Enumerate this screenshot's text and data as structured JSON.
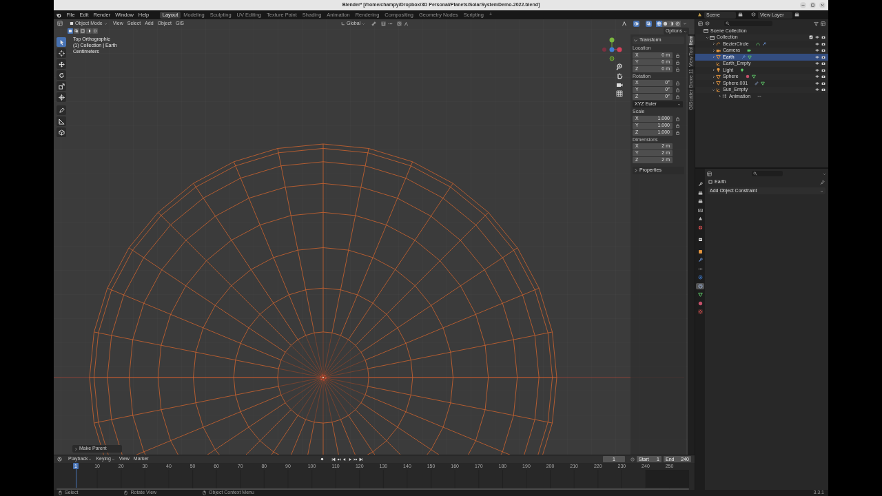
{
  "window": {
    "title": "Blender* [/home/champy/Dropbox/3D Personal/Planets/SolarSystemDemo-2022.blend]"
  },
  "menu": [
    "File",
    "Edit",
    "Render",
    "Window",
    "Help"
  ],
  "workspaces": [
    {
      "label": "Layout",
      "selected": true
    },
    {
      "label": "Modeling",
      "selected": false
    },
    {
      "label": "Sculpting",
      "selected": false
    },
    {
      "label": "UV Editing",
      "selected": false
    },
    {
      "label": "Texture Paint",
      "selected": false
    },
    {
      "label": "Shading",
      "selected": false
    },
    {
      "label": "Animation",
      "selected": false
    },
    {
      "label": "Rendering",
      "selected": false
    },
    {
      "label": "Compositing",
      "selected": false
    },
    {
      "label": "Geometry Nodes",
      "selected": false
    },
    {
      "label": "Scripting",
      "selected": false
    }
  ],
  "add_workspace": "+",
  "scene": "Scene",
  "view_layer": "View Layer",
  "viewport": {
    "mode": "Object Mode",
    "menus": [
      "View",
      "Select",
      "Add",
      "Object",
      "GIS"
    ],
    "orientation": "Global",
    "overlays": true,
    "xray": true,
    "shading": [
      {
        "kind": "wireframe",
        "selected": true
      },
      {
        "kind": "solid",
        "selected": false
      },
      {
        "kind": "material",
        "selected": false
      },
      {
        "kind": "rendered",
        "selected": false
      }
    ],
    "options": "Options",
    "select_modes": [
      {
        "kind": "set",
        "selected": true
      },
      {
        "kind": "extend",
        "selected": false
      },
      {
        "kind": "subtract",
        "selected": false
      },
      {
        "kind": "invert",
        "selected": false
      },
      {
        "kind": "intersect",
        "selected": false
      }
    ],
    "tools": [
      {
        "kind": "select",
        "selected": true
      },
      {
        "kind": "cursor",
        "selected": false
      },
      {
        "kind": "move",
        "selected": false
      },
      {
        "kind": "rotate",
        "selected": false
      },
      {
        "kind": "scale",
        "selected": false
      },
      {
        "kind": "transform",
        "selected": false
      },
      {
        "kind": "annotate",
        "selected": false
      },
      {
        "kind": "measure",
        "selected": false
      },
      {
        "kind": "add_cube",
        "selected": false
      }
    ],
    "overlay_text": [
      "Top Orthographic",
      "(1) Collection | Earth",
      "Centimeters"
    ],
    "last_operator": "Make Parent"
  },
  "sidebar": {
    "tabs": [
      {
        "label": "Item",
        "selected": true
      },
      {
        "label": "Tool",
        "selected": false
      },
      {
        "label": "View",
        "selected": false
      },
      {
        "label": "Grove 11",
        "selected": false
      },
      {
        "label": "GIScatter",
        "selected": false
      }
    ],
    "panels": [
      {
        "title": "Transform",
        "expanded": true,
        "groups": [
          {
            "kind": "vector",
            "label": "Location",
            "lockable": true,
            "fields": [
              {
                "axis": "X",
                "value": "0 m"
              },
              {
                "axis": "Y",
                "value": "0 m"
              },
              {
                "axis": "Z",
                "value": "0 m"
              }
            ]
          },
          {
            "kind": "vector",
            "label": "Rotation",
            "lockable": true,
            "fields": [
              {
                "axis": "X",
                "value": "0°"
              },
              {
                "axis": "Y",
                "value": "0°"
              },
              {
                "axis": "Z",
                "value": "0°"
              }
            ]
          },
          {
            "kind": "dropdown",
            "value": "XYZ Euler"
          },
          {
            "kind": "vector",
            "label": "Scale",
            "lockable": true,
            "fields": [
              {
                "axis": "X",
                "value": "1.000"
              },
              {
                "axis": "Y",
                "value": "1.000"
              },
              {
                "axis": "Z",
                "value": "1.000"
              }
            ]
          },
          {
            "kind": "vector",
            "label": "Dimensions",
            "lockable": false,
            "fields": [
              {
                "axis": "X",
                "value": "2 m"
              },
              {
                "axis": "Y",
                "value": "2 m"
              },
              {
                "axis": "Z",
                "value": "2 m"
              }
            ]
          }
        ]
      },
      {
        "title": "Properties",
        "expanded": false
      }
    ]
  },
  "outliner": {
    "tree": [
      {
        "label": "Scene Collection",
        "kind": "scene_collection",
        "selected": false,
        "children": [
          {
            "label": "Collection",
            "kind": "collection",
            "selected": false,
            "expanded": true,
            "checked": true,
            "visible": true,
            "children": [
              {
                "label": "BezierCircle",
                "kind": "curve",
                "selected": false,
                "expanded": false,
                "visible": true,
                "extras": [
                  {
                    "kind": "curve_data"
                  },
                  {
                    "kind": "modifier"
                  }
                ]
              },
              {
                "label": "Camera",
                "kind": "camera",
                "selected": false,
                "expanded": false,
                "visible": true,
                "extras": [
                  {
                    "kind": "camera_data"
                  }
                ]
              },
              {
                "label": "Earth",
                "kind": "mesh",
                "selected": true,
                "expanded": false,
                "visible": true,
                "extras": [
                  {
                    "kind": "modifier"
                  },
                  {
                    "kind": "mesh_data"
                  }
                ]
              },
              {
                "label": "Earth_Empty",
                "kind": "empty",
                "selected": false,
                "visible": true
              },
              {
                "label": "Light",
                "kind": "light",
                "selected": false,
                "expanded": false,
                "visible": true,
                "extras": [
                  {
                    "kind": "light_data"
                  }
                ]
              },
              {
                "label": "Sphere",
                "kind": "mesh",
                "selected": false,
                "expanded": false,
                "visible": true,
                "extras": [
                  {
                    "kind": "material"
                  },
                  {
                    "kind": "mesh_data"
                  }
                ]
              },
              {
                "label": "Sphere.001",
                "kind": "mesh",
                "selected": false,
                "expanded": false,
                "visible": true,
                "extras": [
                  {
                    "kind": "constraint"
                  },
                  {
                    "kind": "mesh_data"
                  }
                ]
              },
              {
                "label": "Sun_Empty",
                "kind": "empty",
                "selected": false,
                "expanded": true,
                "visible": true,
                "children": [
                  {
                    "label": "Animation",
                    "kind": "animation",
                    "selected": false,
                    "expanded": false,
                    "extras": [
                      {
                        "kind": "action"
                      }
                    ]
                  }
                ]
              }
            ]
          }
        ]
      }
    ]
  },
  "properties": {
    "tabs": [
      {
        "kind": "tool",
        "selected": false
      },
      {
        "kind": "render",
        "selected": false
      },
      {
        "kind": "output",
        "selected": false
      },
      {
        "kind": "view_layer",
        "selected": false
      },
      {
        "kind": "scene",
        "selected": false
      },
      {
        "kind": "world",
        "selected": false
      },
      {
        "kind": "collection",
        "selected": false
      },
      {
        "kind": "object",
        "selected": false
      },
      {
        "kind": "modifiers",
        "selected": false
      },
      {
        "kind": "particles",
        "selected": false
      },
      {
        "kind": "physics",
        "selected": false
      },
      {
        "kind": "constraints",
        "selected": true
      },
      {
        "kind": "data",
        "selected": false
      },
      {
        "kind": "material",
        "selected": false
      },
      {
        "kind": "texture",
        "selected": false
      }
    ],
    "object_name": "Earth",
    "add_button": "Add Object Constraint"
  },
  "timeline": {
    "menus": [
      "Playback",
      "Keying",
      "View",
      "Marker"
    ],
    "current_frame": "1",
    "start_label": "Start",
    "start": "1",
    "end_label": "End",
    "end": "240",
    "playhead": "1",
    "ticks": [
      "10",
      "20",
      "30",
      "40",
      "50",
      "60",
      "70",
      "80",
      "90",
      "100",
      "110",
      "120",
      "130",
      "140",
      "150",
      "160",
      "170",
      "180",
      "190",
      "200",
      "210",
      "220",
      "230",
      "240",
      "250"
    ]
  },
  "status_bar": {
    "hints": [
      {
        "kind": "left_click",
        "label": "Select"
      },
      {
        "kind": "middle_click",
        "label": "Rotate View"
      },
      {
        "kind": "right_click",
        "label": "Object Context Menu"
      }
    ],
    "version": "3.3.1"
  }
}
